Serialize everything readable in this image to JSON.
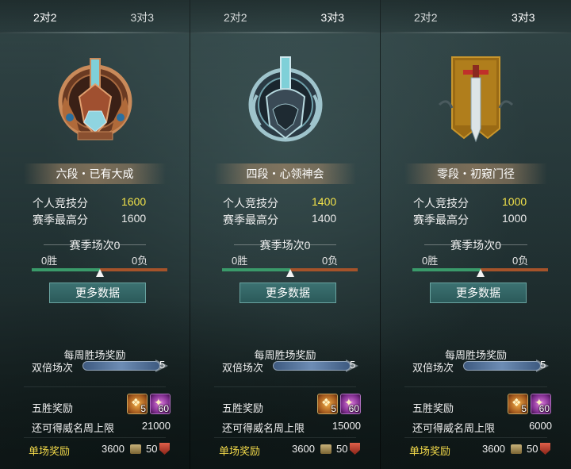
{
  "tabs": [
    "2对2",
    "3对3"
  ],
  "active_tabs": [
    0,
    1,
    1
  ],
  "labels": {
    "individual_score": "个人竞技分",
    "season_high": "赛季最高分",
    "season_matches": "赛季场次0",
    "more_data": "更多数据",
    "weekly_reward": "每周胜场奖励",
    "double_matches": "双倍场次",
    "five_win_reward": "五胜奖励",
    "fame_cap": "还可得威名周上限",
    "single_reward": "单场奖励"
  },
  "panels": [
    {
      "rank_title": "六段・已有大成",
      "emblem": "bronze-tier-emblem",
      "individual_score": "1600",
      "season_high": "1600",
      "wins": "0胜",
      "losses": "0负",
      "win_fraction": 0.5,
      "double_count": "5",
      "double_fill_fraction": 0.0,
      "items": [
        {
          "icon": "gift-box-icon",
          "count": "5"
        },
        {
          "icon": "purple-gem-icon",
          "count": "60"
        }
      ],
      "fame_cap": "21000",
      "single_coin": "3600",
      "single_shield": "50"
    },
    {
      "rank_title": "四段・心领神会",
      "emblem": "silver-tier-emblem",
      "individual_score": "1400",
      "season_high": "1400",
      "wins": "0胜",
      "losses": "0负",
      "win_fraction": 0.5,
      "double_count": "5",
      "double_fill_fraction": 0.0,
      "items": [
        {
          "icon": "gift-box-icon",
          "count": "5"
        },
        {
          "icon": "purple-gem-icon",
          "count": "60"
        }
      ],
      "fame_cap": "15000",
      "single_coin": "3600",
      "single_shield": "50"
    },
    {
      "rank_title": "零段・初窥门径",
      "emblem": "banner-sword-emblem",
      "individual_score": "1000",
      "season_high": "1000",
      "wins": "0胜",
      "losses": "0负",
      "win_fraction": 0.5,
      "double_count": "5",
      "double_fill_fraction": 0.0,
      "items": [
        {
          "icon": "gift-box-icon",
          "count": "5"
        },
        {
          "icon": "purple-gem-icon",
          "count": "60"
        }
      ],
      "fame_cap": "6000",
      "single_coin": "3600",
      "single_shield": "50"
    }
  ],
  "colors": {
    "score_highlight": "#f2e24a",
    "single_reward_label": "#f2d94a",
    "win_bar": "#3a9a6a",
    "loss_bar": "#a5532a"
  }
}
